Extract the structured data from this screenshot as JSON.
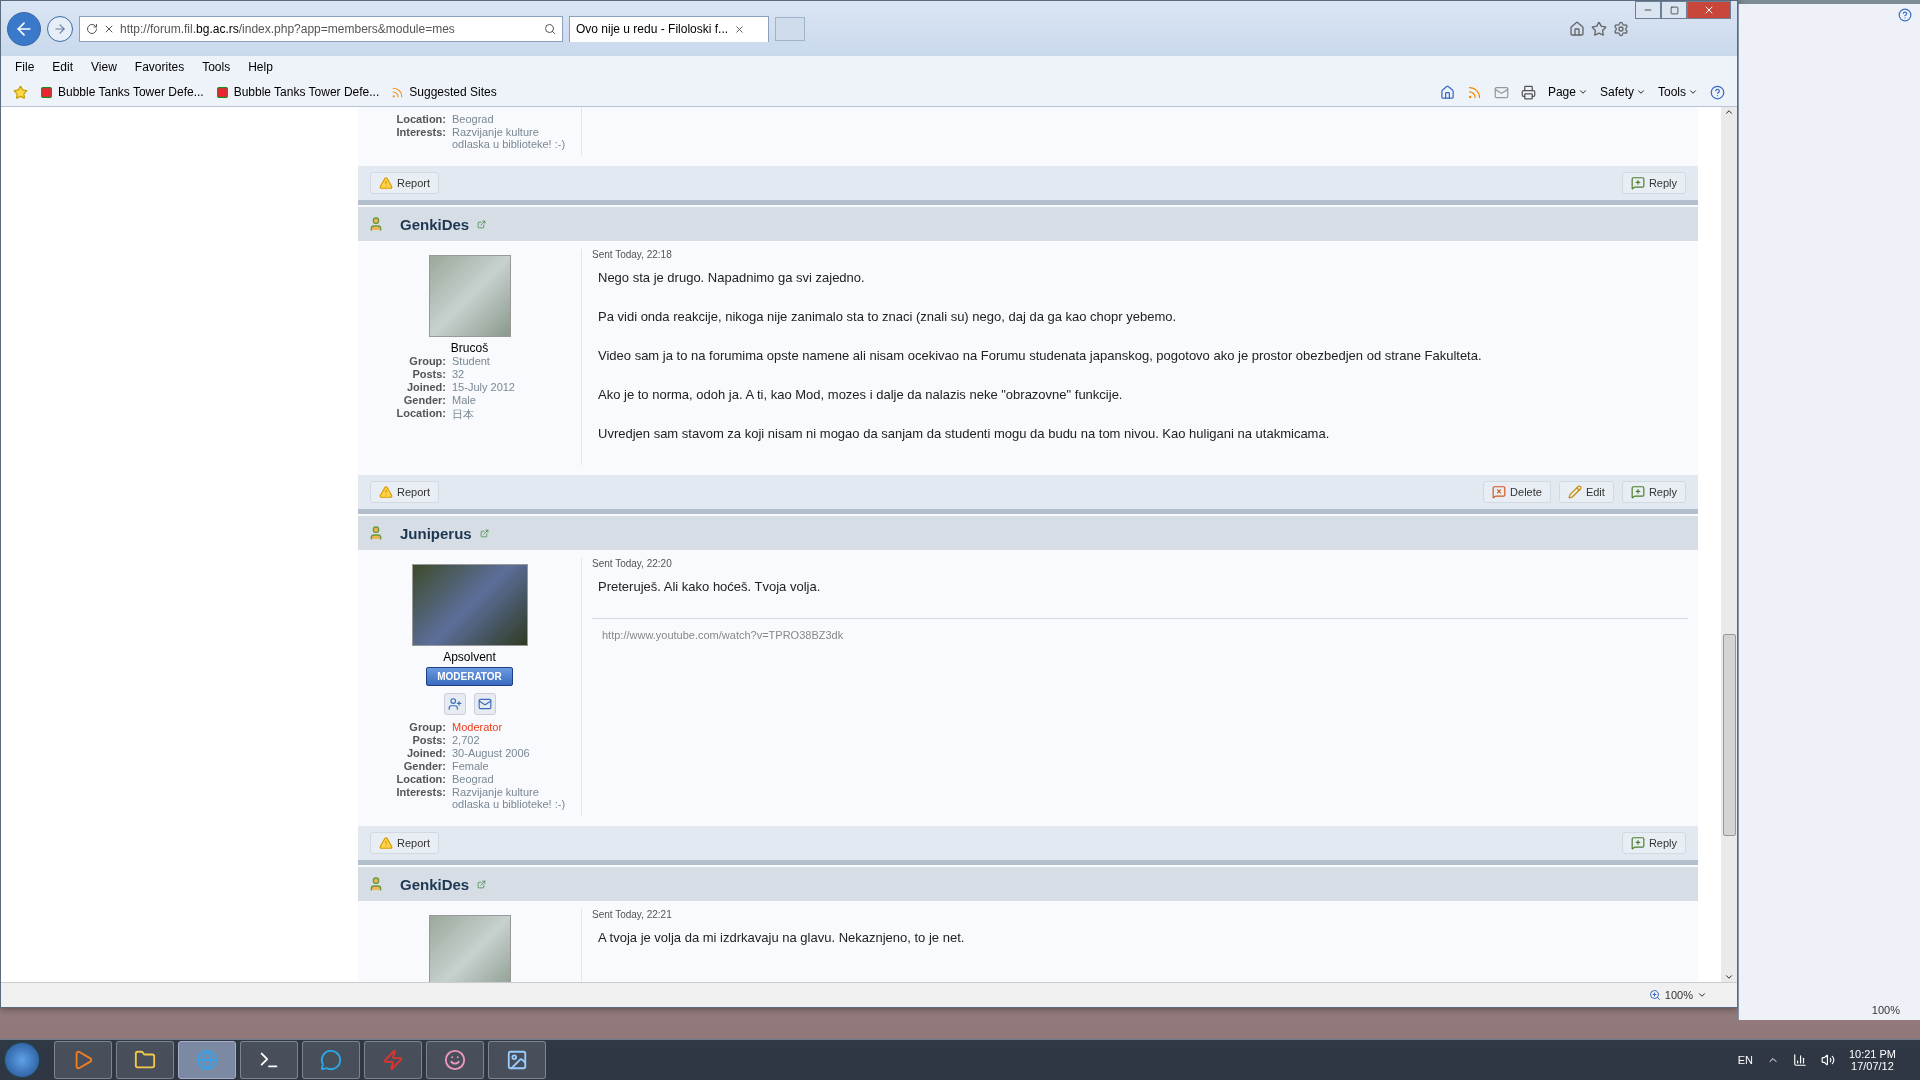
{
  "browser": {
    "address": "http://forum.fil.**bg.ac.rs**/index.php?app=members&module=mes",
    "tab_title": "Ovo nije u redu - Filoloski f...",
    "menu": [
      "File",
      "Edit",
      "View",
      "Favorites",
      "Tools",
      "Help"
    ],
    "favorites": [
      "Bubble Tanks Tower Defe...",
      "Bubble Tanks Tower Defe...",
      "Suggested Sites"
    ],
    "command_bar": [
      "Page",
      "Safety",
      "Tools"
    ],
    "zoom": "100%"
  },
  "posts": [
    {
      "partial": true,
      "profile": [
        {
          "label": "Location:",
          "value": "Beograd",
          "highlighted": false
        },
        {
          "label": "Interests:",
          "value": "Razvijanje kulture odlaska u biblioteke! :-)",
          "highlighted": false
        }
      ],
      "actions": [
        {
          "kind": "report",
          "label": "Report"
        },
        {
          "kind": "reply",
          "label": "Reply"
        }
      ]
    },
    {
      "partial": false,
      "author": "GenkiDes",
      "sent": "Sent Today, 22:18",
      "rank": "Brucoš",
      "contact_icons": false,
      "profile": [
        {
          "label": "Group:",
          "value": "Student",
          "highlighted": false
        },
        {
          "label": "Posts:",
          "value": "32",
          "highlighted": false
        },
        {
          "label": "Joined:",
          "value": "15-July 2012",
          "highlighted": false
        },
        {
          "label": "Gender:",
          "value": "Male",
          "highlighted": false
        },
        {
          "label": "Location:",
          "value": "日本",
          "highlighted": false
        }
      ],
      "paragraphs": [
        "Nego sta je drugo. Napadnimo ga svi zajedno.",
        "Pa vidi onda reakcije, nikoga nije zanimalo sta to znaci (znali su) nego, daj da ga kao chopr yebemo.",
        "Video sam ja to na forumima opste namene ali nisam ocekivao na Forumu studenata japanskog, pogotovo ako je prostor obezbedjen od strane Fakulteta.",
        "Ako je to norma, odoh ja. A ti, kao Mod, mozes i dalje da nalazis neke \"obrazovne\" funkcije.",
        "Uvredjen sam stavom za koji nisam ni mogao da sanjam da studenti mogu da budu na tom nivou. Kao huligani na utakmicama."
      ],
      "actions": [
        {
          "kind": "report",
          "label": "Report"
        },
        {
          "kind": "delete",
          "label": "Delete"
        },
        {
          "kind": "edit",
          "label": "Edit"
        },
        {
          "kind": "reply",
          "label": "Reply"
        }
      ]
    },
    {
      "partial": false,
      "author": "Juniperus",
      "sent": "Sent Today, 22:20",
      "rank": "Apsolvent",
      "badge": "MODERATOR",
      "contact_icons": true,
      "profile": [
        {
          "label": "Group:",
          "value": "Moderator",
          "highlighted": true
        },
        {
          "label": "Posts:",
          "value": "2,702",
          "highlighted": false
        },
        {
          "label": "Joined:",
          "value": "30-August 2006",
          "highlighted": false
        },
        {
          "label": "Gender:",
          "value": "Female",
          "highlighted": false
        },
        {
          "label": "Location:",
          "value": "Beograd",
          "highlighted": false
        },
        {
          "label": "Interests:",
          "value": "Razvijanje kulture odlaska u biblioteke! :-)",
          "highlighted": false
        }
      ],
      "paragraphs": [
        "Preteruješ. Ali kako hoćeš. Tvoja volja."
      ],
      "signature": "http://www.youtube.com/watch?v=TPRO38BZ3dk",
      "actions": [
        {
          "kind": "report",
          "label": "Report"
        },
        {
          "kind": "reply",
          "label": "Reply"
        }
      ]
    },
    {
      "partial": false,
      "author": "GenkiDes",
      "sent": "Sent Today, 22:21",
      "contact_icons": false,
      "paragraphs": [
        "A tvoja je volja da mi izdrkavaju na glavu. Nekaznjeno, to je net."
      ]
    }
  ],
  "background_window": {
    "zoom": "100%"
  },
  "taskbar": {
    "items": [
      {
        "kind": "media",
        "selected": false
      },
      {
        "kind": "folder",
        "selected": false
      },
      {
        "kind": "browser",
        "selected": true
      },
      {
        "kind": "terminal",
        "selected": false
      },
      {
        "kind": "chat",
        "selected": false
      },
      {
        "kind": "ftp",
        "selected": false
      },
      {
        "kind": "app",
        "selected": false
      },
      {
        "kind": "image",
        "selected": false
      }
    ],
    "language": "EN",
    "time": "10:21 PM",
    "date": "17/07/12"
  }
}
